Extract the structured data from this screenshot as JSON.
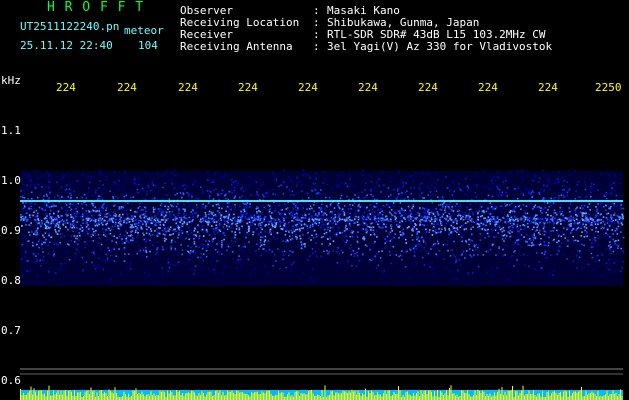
{
  "header": {
    "program_name": "H R O F F T",
    "file_name": "UT2511122240.pn",
    "meteor_label": "meteor",
    "datetime": "25.11.12 22:40",
    "meteor_count": "104",
    "info_labels": [
      "Observer",
      "Receiving Location",
      "Receiver",
      "Receiving Antenna"
    ],
    "info_colons": [
      ":",
      ":",
      ":",
      ":"
    ],
    "info_values": [
      "Masaki Kano",
      "Shibukawa, Gunma, Japan",
      "RTL-SDR SDR# 43dB L15 103.2MHz CW",
      "3el Yagi(V) Az 330 for Vladivostok"
    ]
  },
  "plot": {
    "y_unit": "kHz",
    "y_ticks": [
      {
        "label": "1.1",
        "value": 1.1
      },
      {
        "label": "1.0",
        "value": 1.0
      },
      {
        "label": "0.9",
        "value": 0.9
      },
      {
        "label": "0.8",
        "value": 0.8
      },
      {
        "label": "0.7",
        "value": 0.7
      },
      {
        "label": "0.6",
        "value": 0.6
      }
    ],
    "x_tick_labels": [
      "224",
      "224",
      "224",
      "224",
      "224",
      "224",
      "224",
      "224",
      "224",
      "2250"
    ],
    "colors": {
      "background": "#000000",
      "text_info": "#ffffff",
      "text_title": "#00ff33",
      "axis_labels": "#ffff00",
      "y_labels": "#ffffff",
      "noise_low": "#0000aa",
      "noise_high": "#66aaff",
      "carrier": "#66ffff",
      "bottom_bar_bg": "#00bbff",
      "bottom_bar_peaks": "#ffff00"
    },
    "signal": {
      "carrier_khz": 0.96,
      "band_khz": [
        0.79,
        1.02
      ]
    }
  }
}
